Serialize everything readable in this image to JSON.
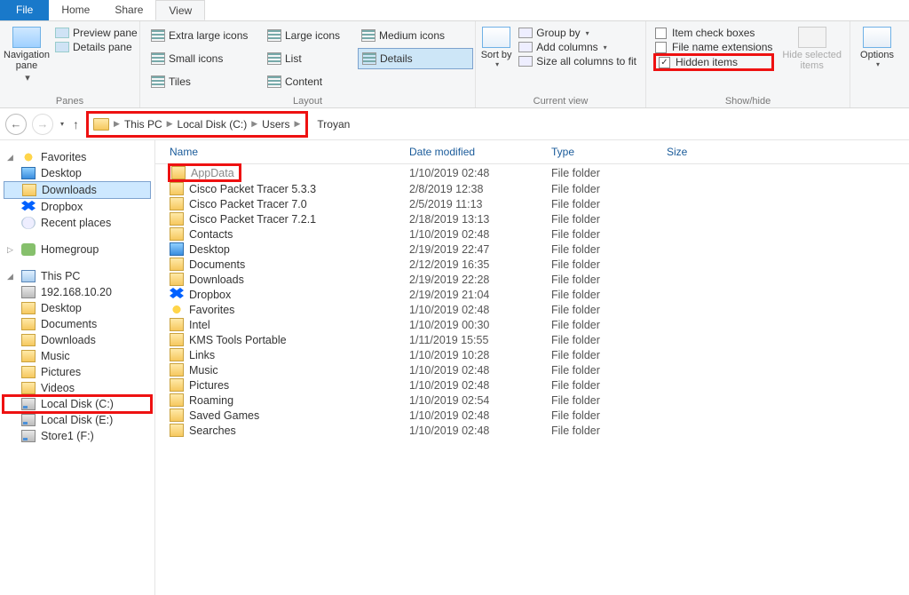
{
  "tabs": {
    "file": "File",
    "home": "Home",
    "share": "Share",
    "view": "View"
  },
  "ribbon": {
    "panes": {
      "label": "Panes",
      "nav": "Navigation pane",
      "preview": "Preview pane",
      "details": "Details pane"
    },
    "layout": {
      "label": "Layout",
      "xl": "Extra large icons",
      "large": "Large icons",
      "medium": "Medium icons",
      "small": "Small icons",
      "list": "List",
      "details": "Details",
      "tiles": "Tiles",
      "content": "Content"
    },
    "currentview": {
      "label": "Current view",
      "sort": "Sort by",
      "group": "Group by",
      "addcols": "Add columns",
      "sizecols": "Size all columns to fit"
    },
    "showhide": {
      "label": "Show/hide",
      "itemchk": "Item check boxes",
      "ext": "File name extensions",
      "hidden": "Hidden items",
      "hidesel": "Hide selected items"
    },
    "options": "Options"
  },
  "breadcrumb": [
    "This PC",
    "Local Disk (C:)",
    "Users",
    "Troyan"
  ],
  "sidebar": {
    "favorites": "Favorites",
    "fav_items": [
      "Desktop",
      "Downloads",
      "Dropbox",
      "Recent places"
    ],
    "homegroup": "Homegroup",
    "thispc": "This PC",
    "pc_items": [
      "192.168.10.20",
      "Desktop",
      "Documents",
      "Downloads",
      "Music",
      "Pictures",
      "Videos",
      "Local Disk (C:)",
      "Local Disk (E:)",
      "Store1 (F:)"
    ]
  },
  "columns": {
    "name": "Name",
    "date": "Date modified",
    "type": "Type",
    "size": "Size"
  },
  "files": [
    {
      "n": "AppData",
      "d": "1/10/2019 02:48",
      "t": "File folder",
      "hl": true,
      "dim": true
    },
    {
      "n": "Cisco Packet Tracer 5.3.3",
      "d": "2/8/2019 12:38",
      "t": "File folder"
    },
    {
      "n": "Cisco Packet Tracer 7.0",
      "d": "2/5/2019 11:13",
      "t": "File folder"
    },
    {
      "n": "Cisco Packet Tracer 7.2.1",
      "d": "2/18/2019 13:13",
      "t": "File folder"
    },
    {
      "n": "Contacts",
      "d": "1/10/2019 02:48",
      "t": "File folder",
      "ico": "contacts"
    },
    {
      "n": "Desktop",
      "d": "2/19/2019 22:47",
      "t": "File folder",
      "ico": "desktop"
    },
    {
      "n": "Documents",
      "d": "2/12/2019 16:35",
      "t": "File folder"
    },
    {
      "n": "Downloads",
      "d": "2/19/2019 22:28",
      "t": "File folder"
    },
    {
      "n": "Dropbox",
      "d": "2/19/2019 21:04",
      "t": "File folder",
      "ico": "dropbox"
    },
    {
      "n": "Favorites",
      "d": "1/10/2019 02:48",
      "t": "File folder",
      "ico": "star"
    },
    {
      "n": "Intel",
      "d": "1/10/2019 00:30",
      "t": "File folder"
    },
    {
      "n": "KMS Tools Portable",
      "d": "1/11/2019 15:55",
      "t": "File folder"
    },
    {
      "n": "Links",
      "d": "1/10/2019 10:28",
      "t": "File folder"
    },
    {
      "n": "Music",
      "d": "1/10/2019 02:48",
      "t": "File folder"
    },
    {
      "n": "Pictures",
      "d": "1/10/2019 02:48",
      "t": "File folder"
    },
    {
      "n": "Roaming",
      "d": "1/10/2019 02:54",
      "t": "File folder"
    },
    {
      "n": "Saved Games",
      "d": "1/10/2019 02:48",
      "t": "File folder"
    },
    {
      "n": "Searches",
      "d": "1/10/2019 02:48",
      "t": "File folder"
    }
  ]
}
